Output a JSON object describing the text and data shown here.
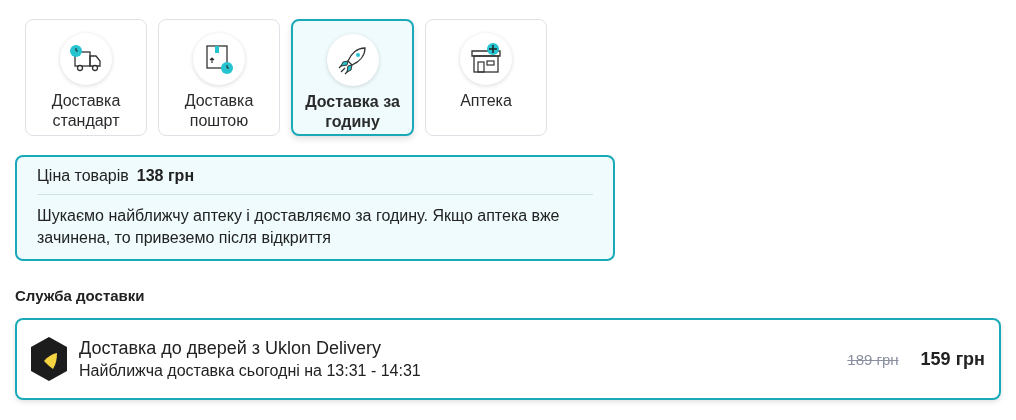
{
  "delivery_options": [
    {
      "kind": "truck",
      "label": "Доставка стандарт",
      "selected": false
    },
    {
      "kind": "parcel",
      "label": "Доставка поштою",
      "selected": false
    },
    {
      "kind": "rocket",
      "label": "Доставка за годину",
      "selected": true
    },
    {
      "kind": "pharmacy",
      "label": "Аптека",
      "selected": false
    }
  ],
  "info": {
    "price_label": "Ціна товарів",
    "price_value": "138 грн",
    "description": "Шукаємо найближчу аптеку і доставляємо за годину. Якщо аптека вже зачинена, то привеземо після відкриття"
  },
  "service_heading": "Служба доставки",
  "service": {
    "title": "Доставка до дверей з Uklon Delivery",
    "subtitle": "Найближча доставка сьогодні на 13:31 - 14:31",
    "old_price": "189 грн",
    "price": "159 грн",
    "selected": true
  }
}
